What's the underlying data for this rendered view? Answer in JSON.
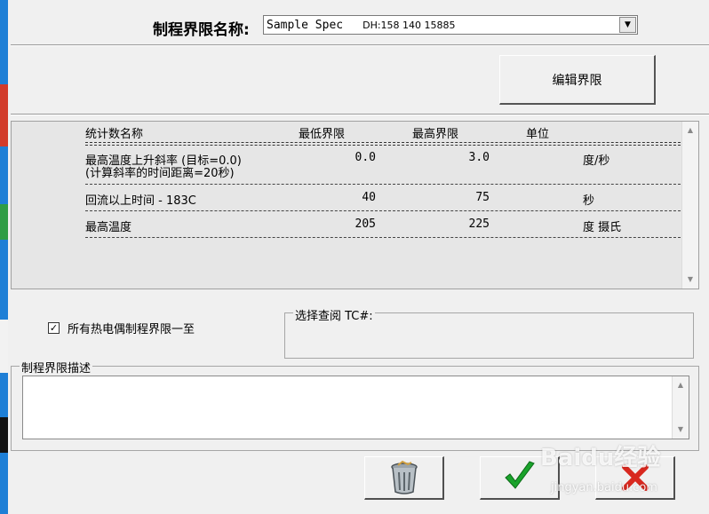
{
  "spec": {
    "label": "制程界限名称:",
    "value": "Sample Spec",
    "value_extra": "DH:158 140 15885"
  },
  "buttons": {
    "edit_limits": "编辑界限"
  },
  "table": {
    "headers": [
      "统计数名称",
      "最低界限",
      "最高界限",
      "单位"
    ],
    "rows": [
      {
        "name": "最高温度上升斜率 (目标=0.0)",
        "name2": "(计算斜率的时间距离=20秒)",
        "min": "0.0",
        "max": "3.0",
        "unit": "度/秒"
      },
      {
        "name": "回流以上时间 - 183C",
        "min": "40",
        "max": "75",
        "unit": "秒"
      },
      {
        "name": "最高温度",
        "min": "205",
        "max": "225",
        "unit": "度 摄氏"
      }
    ]
  },
  "checkbox": {
    "label": "所有热电偶制程界限一至",
    "checked": true
  },
  "select_tc": {
    "label": "选择查阅 TC#:"
  },
  "description": {
    "label": "制程界限描述",
    "value": ""
  },
  "watermark": {
    "text": "Baidu经验",
    "url": "jingyan.baidu.com"
  },
  "colors": {
    "accent_green": "#1aa32b",
    "accent_red": "#d8281f"
  },
  "icons": [
    "trash-icon",
    "checkmark-icon",
    "cancel-x-icon",
    "chevron-down-icon",
    "scroll-up-icon",
    "scroll-down-icon"
  ]
}
